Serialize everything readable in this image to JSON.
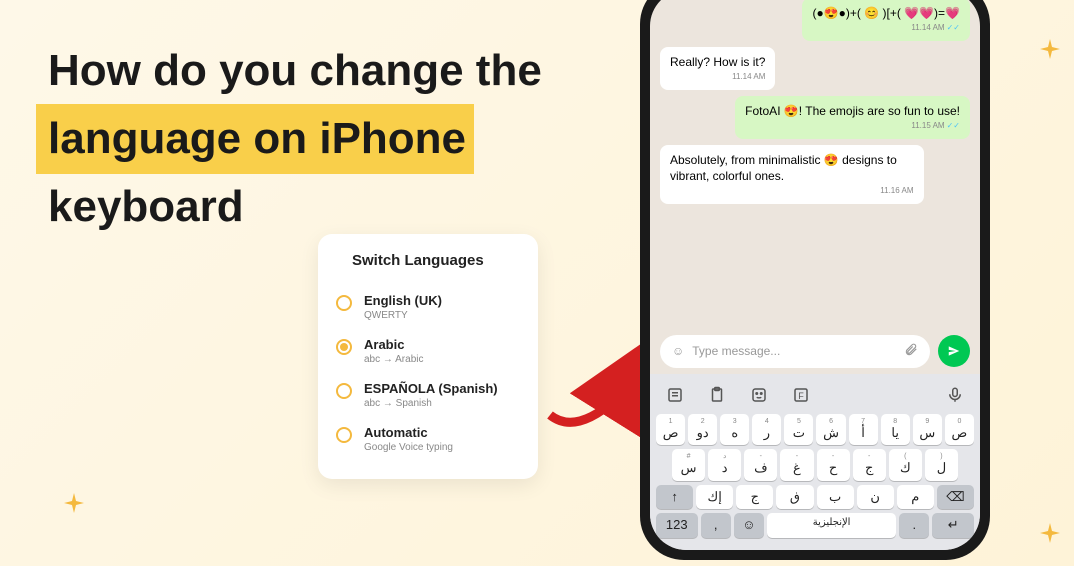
{
  "headline": {
    "line1": "How do you change the",
    "line2": "language on iPhone",
    "line3": "keyboard"
  },
  "langCard": {
    "title": "Switch Languages",
    "items": [
      {
        "name": "English (UK)",
        "sub": "QWERTY",
        "selected": false
      },
      {
        "name": "Arabic",
        "sub": "abc → Arabic",
        "selected": true
      },
      {
        "name": "ESPAÑOLA (Spanish)",
        "sub": "abc → Spanish",
        "selected": false
      },
      {
        "name": "Automatic",
        "sub": "Google Voice typing",
        "selected": false
      }
    ]
  },
  "chat": {
    "messages": [
      {
        "dir": "out",
        "text": "(●😍●)+( 😊 )[+( 💗💗)=💗",
        "time": "11.14 AM",
        "ticks": true
      },
      {
        "dir": "in",
        "text": "Really? How is it?",
        "time": "11.14 AM",
        "ticks": false
      },
      {
        "dir": "out",
        "text": "FotoAI 😍! The emojis are so fun to use!",
        "time": "11.15 AM",
        "ticks": true
      },
      {
        "dir": "in",
        "text": "Absolutely, from minimalistic 😍 designs to vibrant, colorful ones.",
        "time": "11.16 AM",
        "ticks": false
      }
    ],
    "placeholder": "Type message..."
  },
  "keyboard": {
    "row1": [
      {
        "sup": "1",
        "main": "ص"
      },
      {
        "sup": "2",
        "main": "دو"
      },
      {
        "sup": "3",
        "main": "ه"
      },
      {
        "sup": "4",
        "main": "ر"
      },
      {
        "sup": "5",
        "main": "ت"
      },
      {
        "sup": "6",
        "main": "ش"
      },
      {
        "sup": "7",
        "main": "أ"
      },
      {
        "sup": "8",
        "main": "يا"
      },
      {
        "sup": "9",
        "main": "س"
      },
      {
        "sup": "0",
        "main": "ص"
      }
    ],
    "row2": [
      {
        "sup": "#",
        "main": "س"
      },
      {
        "sup": "د",
        "main": "د"
      },
      {
        "sup": "-",
        "main": "ف"
      },
      {
        "sup": "-",
        "main": "غ"
      },
      {
        "sup": "-",
        "main": "ح"
      },
      {
        "sup": "-",
        "main": "ج"
      },
      {
        "sup": "(",
        "main": "ك"
      },
      {
        "sup": ")",
        "main": "ل"
      }
    ],
    "row3": [
      {
        "main": "↑",
        "dark": true
      },
      {
        "main": "إك"
      },
      {
        "main": "ج"
      },
      {
        "main": "ڧ"
      },
      {
        "main": "ب"
      },
      {
        "main": "ن"
      },
      {
        "main": "م"
      },
      {
        "main": "⌫",
        "dark": true
      }
    ],
    "row4": {
      "numKey": "123",
      "comma": ",",
      "emoji": "☺",
      "space": "الإنجليزية",
      "dot": ".",
      "enter": "↵"
    }
  }
}
